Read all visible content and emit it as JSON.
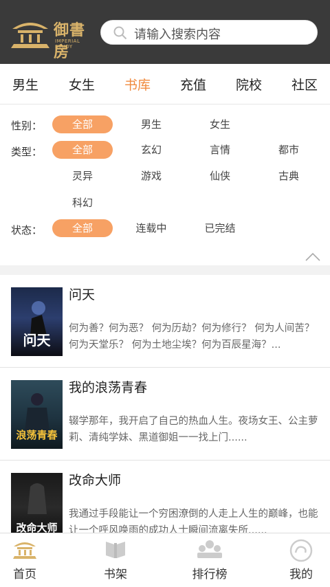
{
  "header": {
    "logo_text": "御書房",
    "logo_sub": "IMPERIAL STUDY",
    "search_placeholder": "请输入搜索内容",
    "brand_color": "#d9b36a"
  },
  "nav": {
    "items": [
      "男生",
      "女生",
      "书库",
      "充值",
      "院校",
      "社区"
    ],
    "active_index": 2,
    "accent_color": "#f08a3e"
  },
  "filters": {
    "gender": {
      "label": "性别：",
      "options": [
        "全部",
        "男生",
        "女生"
      ],
      "selected": 0
    },
    "type": {
      "label": "类型：",
      "options": [
        "全部",
        "玄幻",
        "言情",
        "都市",
        "灵异",
        "游戏",
        "仙侠",
        "古典",
        "科幻"
      ],
      "selected": 0
    },
    "status": {
      "label": "状态：",
      "options": [
        "全部",
        "连载中",
        "已完结"
      ],
      "selected": 0
    },
    "collapse_icon": "chevron-up-icon"
  },
  "books": [
    {
      "title": "问天",
      "desc": "何为善？何为恶？ 何为历劫？何为修行？ 何为人间苦？何为天堂乐？ 何为土地尘埃？何为百辰星海？...",
      "cover_text": "问天"
    },
    {
      "title": "我的浪荡青春",
      "desc": "辍学那年，我开启了自己的热血人生。夜场女王、公主萝莉、清纯学妹、黑道御姐一一找上门......",
      "cover_text": "浪荡青春"
    },
    {
      "title": "改命大师",
      "desc": "我通过手段能让一个穷困潦倒的人走上人生的巅峰，也能让一个呼风唤雨的成功人士瞬间流离失所......",
      "cover_text": "改命大师"
    }
  ],
  "tabbar": {
    "items": [
      {
        "label": "首页",
        "icon": "home-palace-icon"
      },
      {
        "label": "书架",
        "icon": "bookshelf-icon"
      },
      {
        "label": "排行榜",
        "icon": "ranking-icon"
      },
      {
        "label": "我的",
        "icon": "profile-icon"
      }
    ]
  }
}
